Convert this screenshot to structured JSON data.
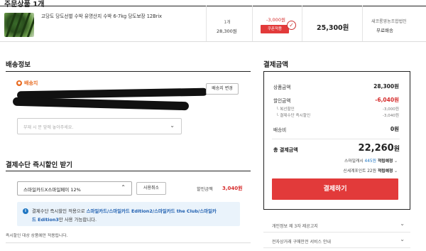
{
  "order": {
    "section_title": "주문상품 1개",
    "product_name": "고당도 당도선별 수박 유명산지 수박 6-7kg 당도보장 12Brix",
    "qty": "1개",
    "unit_price": "28,300원",
    "discount": "-3,000원",
    "coupon_button": "쿠폰적용",
    "final_price": "25,300원",
    "shipping_company": "새코롱영농조합법인",
    "shipping_type": "무료배송"
  },
  "shipping": {
    "title": "배송정보",
    "destination_label": "배송지",
    "change_button": "배송지 변경",
    "memo_placeholder": "부재 시 문 앞에 놓아주세요."
  },
  "instant_discount": {
    "title": "결제수단 즉시할인 받기",
    "card_selected": "스마일카드X스마일페이 12%",
    "cancel_button": "사용취소",
    "discount_label": "할인금액",
    "discount_value": "3,040원",
    "info_prefix": "결제수단 즉시할인 적용으로 ",
    "info_cards": "스마일카드/스마일카드 Edition2/스마일카드 the Club/스마일카",
    "info_cards2": "드 Edition3",
    "info_suffix": "만 사용 가능합니다.",
    "footnote": "즉시할인 대상 상품에만 적용됩니다."
  },
  "payment": {
    "title": "결제금액",
    "product_amount_label": "상품금액",
    "product_amount": "28,300원",
    "discount_label": "할인금액",
    "discount_amount": "-6,040원",
    "sub_discounts": [
      {
        "label": "└ 복선할인",
        "value": "-3,000원"
      },
      {
        "label": "└ 결제수단 즉시할인",
        "value": "-3,040원"
      }
    ],
    "shipping_label": "배송비",
    "shipping_amount": "0원",
    "total_label": "총 결제금액",
    "total_amount": "22,260",
    "total_unit": "원",
    "smile_cash_prefix": "스마일캐시 ",
    "smile_cash_value": "445원",
    "smile_cash_suffix": " 적립예정",
    "shinsegae_prefix": "신세계포인트 ",
    "shinsegae_value": "22원",
    "shinsegae_suffix": " 적립예정",
    "pay_button": "결제하기",
    "accordions": [
      "개인정보 제 3자 제공고지",
      "전자상거래 구매안전 서비스 안내"
    ]
  },
  "colors": {
    "accent_red": "#e23a3a",
    "discount_red": "#d62c2c",
    "info_blue": "#1f76c2",
    "dest_orange": "#e86a1f"
  }
}
